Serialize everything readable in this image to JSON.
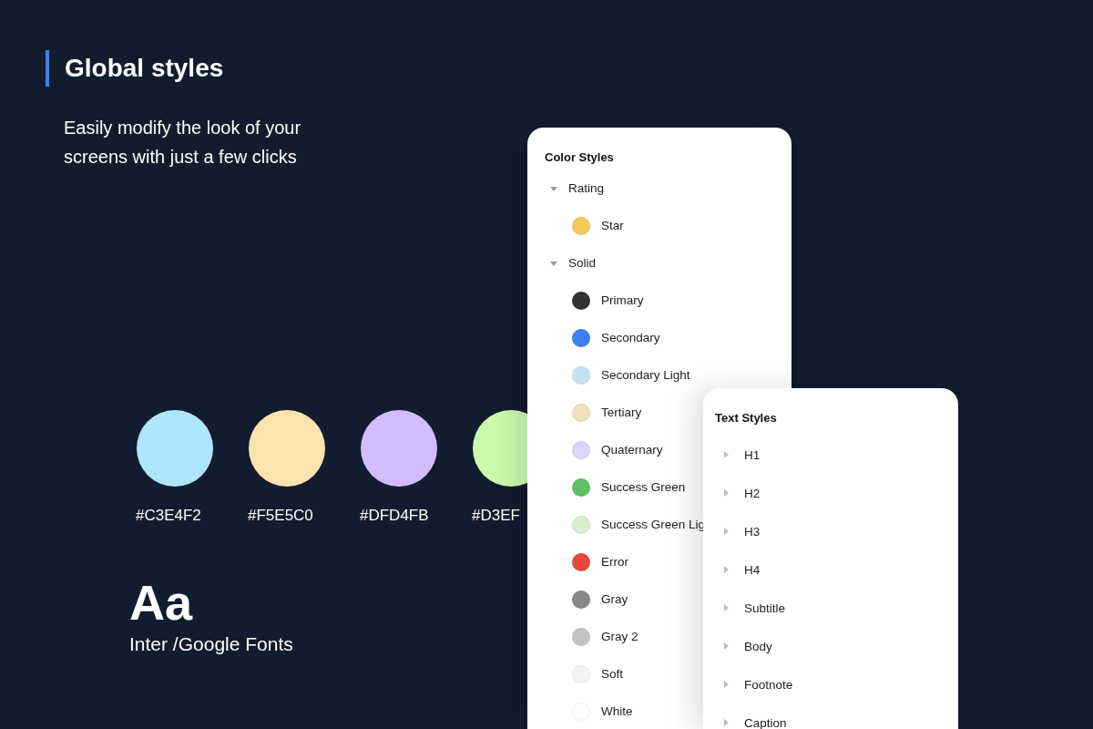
{
  "heading": {
    "title": "Global styles",
    "subtitle": "Easily modify the look of your screens with just a few clicks"
  },
  "swatches": [
    {
      "color": "#b0e6fd",
      "label": "#C3E4F2"
    },
    {
      "color": "#fde3ae",
      "label": "#F5E5C0"
    },
    {
      "color": "#d2bcfd",
      "label": "#DFD4FB"
    },
    {
      "color": "#ccfbac",
      "label": "#D3EF"
    }
  ],
  "font_sample": {
    "glyphs": "Aa",
    "name": "Inter /Google Fonts"
  },
  "color_styles": {
    "title": "Color Styles",
    "groups": [
      {
        "label": "Rating",
        "expanded": true,
        "children": [
          {
            "label": "Star",
            "color": "#f6c85a"
          }
        ]
      },
      {
        "label": "Solid",
        "expanded": true,
        "children": [
          {
            "label": "Primary",
            "color": "#333333"
          },
          {
            "label": "Secondary",
            "color": "#3f81f4"
          },
          {
            "label": "Secondary Light",
            "color": "#c6e2f0"
          },
          {
            "label": "Tertiary",
            "color": "#f0e2c0"
          },
          {
            "label": "Quaternary",
            "color": "#ddd5f9"
          },
          {
            "label": "Success Green",
            "color": "#5ec265"
          },
          {
            "label": "Success Green Lig",
            "color": "#d6efcc"
          },
          {
            "label": "Error",
            "color": "#e8493c"
          },
          {
            "label": "Gray",
            "color": "#888888"
          },
          {
            "label": "Gray 2",
            "color": "#c4c4c4"
          },
          {
            "label": "Soft",
            "color": "#f4f4f4"
          },
          {
            "label": "White",
            "color": "#ffffff"
          }
        ]
      }
    ]
  },
  "text_styles": {
    "title": "Text Styles",
    "items": [
      {
        "label": "H1",
        "expanded": false
      },
      {
        "label": "H2",
        "expanded": false
      },
      {
        "label": "H3",
        "expanded": false
      },
      {
        "label": "H4",
        "expanded": false
      },
      {
        "label": "Subtitle",
        "expanded": false
      },
      {
        "label": "Body",
        "expanded": false
      },
      {
        "label": "Footnote",
        "expanded": false
      },
      {
        "label": "Caption",
        "expanded": false
      }
    ]
  }
}
